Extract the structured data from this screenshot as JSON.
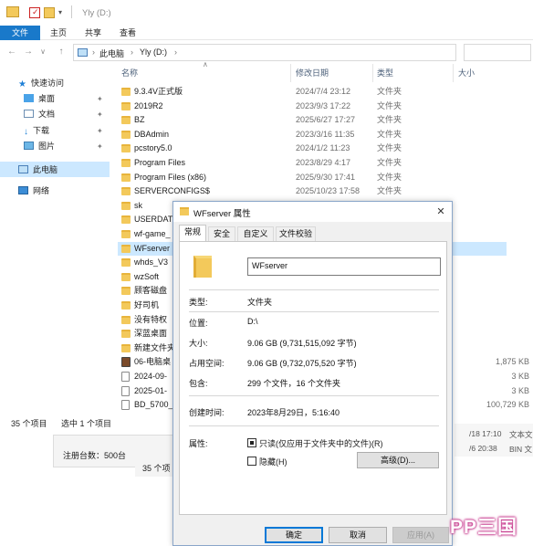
{
  "window": {
    "title": "Yly (D:)"
  },
  "ribbon": {
    "tabs": [
      "文件",
      "主页",
      "共享",
      "查看"
    ]
  },
  "address": {
    "path": [
      "此电脑",
      "Yly (D:)"
    ]
  },
  "nav": {
    "items": [
      {
        "label": "快速访问",
        "icon": "star-icon"
      },
      {
        "label": "桌面",
        "icon": "desktop-folder-icon"
      },
      {
        "label": "文档",
        "icon": "documents-icon"
      },
      {
        "label": "下载",
        "icon": "download-icon"
      },
      {
        "label": "图片",
        "icon": "pictures-icon"
      },
      {
        "label": "此电脑",
        "icon": "computer-icon"
      },
      {
        "label": "网络",
        "icon": "network-icon"
      }
    ]
  },
  "columns": {
    "name": "名称",
    "date": "修改日期",
    "type": "类型",
    "size": "大小"
  },
  "files": [
    {
      "name": "9.3.4V正式版",
      "date": "2024/7/4 23:12",
      "type": "文件夹",
      "size": ""
    },
    {
      "name": "2019R2",
      "date": "2023/9/3 17:22",
      "type": "文件夹",
      "size": ""
    },
    {
      "name": "BZ",
      "date": "2025/6/27 17:27",
      "type": "文件夹",
      "size": ""
    },
    {
      "name": "DBAdmin",
      "date": "2023/3/16 11:35",
      "type": "文件夹",
      "size": ""
    },
    {
      "name": "pcstory5.0",
      "date": "2024/1/2 11:23",
      "type": "文件夹",
      "size": ""
    },
    {
      "name": "Program Files",
      "date": "2023/8/29 4:17",
      "type": "文件夹",
      "size": ""
    },
    {
      "name": "Program Files (x86)",
      "date": "2025/9/30 17:41",
      "type": "文件夹",
      "size": ""
    },
    {
      "name": "SERVERCONFIGS$",
      "date": "2025/10/23 17:58",
      "type": "文件夹",
      "size": ""
    },
    {
      "name": "sk",
      "date": "",
      "type": "",
      "size": ""
    },
    {
      "name": "USERDAT",
      "date": "",
      "type": "",
      "size": ""
    },
    {
      "name": "wf-game_",
      "date": "",
      "type": "",
      "size": ""
    },
    {
      "name": "WFserver",
      "date": "",
      "type": "",
      "size": ""
    },
    {
      "name": "whds_V3",
      "date": "",
      "type": "",
      "size": ""
    },
    {
      "name": "wzSoft",
      "date": "",
      "type": "",
      "size": ""
    },
    {
      "name": "顾客磁盘",
      "date": "",
      "type": "",
      "size": ""
    },
    {
      "name": "好司机",
      "date": "",
      "type": "",
      "size": ""
    },
    {
      "name": "没有特权",
      "date": "",
      "type": "",
      "size": ""
    },
    {
      "name": "深蓝桌面",
      "date": "",
      "type": "",
      "size": ""
    },
    {
      "name": "新建文件夹",
      "date": "",
      "type": "",
      "size": ""
    },
    {
      "name": "06-电脑桌",
      "date": "",
      "type": "",
      "size": "1,875 KB"
    },
    {
      "name": "2024-09-",
      "date": "",
      "type": "",
      "size": "3 KB"
    },
    {
      "name": "2025-01-",
      "date": "",
      "type": "",
      "size": "3 KB"
    },
    {
      "name": "BD_5700_",
      "date": "",
      "type": "",
      "size": "100,729 KB"
    }
  ],
  "status": {
    "count": "35 个项目",
    "selected": "选中 1 个项目"
  },
  "back_windows": {
    "register_count": "注册台数：500台",
    "count": "35 个项",
    "row1": "/18 17:10",
    "row1_type": "文本文",
    "row2": "/6 20:38",
    "row2_type": "BIN 文"
  },
  "dialog": {
    "title": "WFserver 属性",
    "close_glyph": "✕",
    "tabs": [
      "常规",
      "安全",
      "自定义",
      "文件校验"
    ],
    "name_value": "WFserver",
    "rows": [
      {
        "label": "类型:",
        "value": "文件夹"
      },
      {
        "label": "位置:",
        "value": "D:\\"
      },
      {
        "label": "大小:",
        "value": "9.06 GB (9,731,515,092 字节)"
      },
      {
        "label": "占用空间:",
        "value": "9.06 GB (9,732,075,520 字节)"
      },
      {
        "label": "包含:",
        "value": "299 个文件，16 个文件夹"
      },
      {
        "label": "创建时间:",
        "value": "2023年8月29日，5:16:40"
      }
    ],
    "attributes_label": "属性:",
    "readonly_label": "只读(仅应用于文件夹中的文件)(R)",
    "hidden_label": "隐藏(H)",
    "advanced_button": "高级(D)...",
    "ok_button": "确定",
    "cancel_button": "取消",
    "apply_button": "应用(A)"
  },
  "watermark": {
    "text": "PP三国"
  }
}
